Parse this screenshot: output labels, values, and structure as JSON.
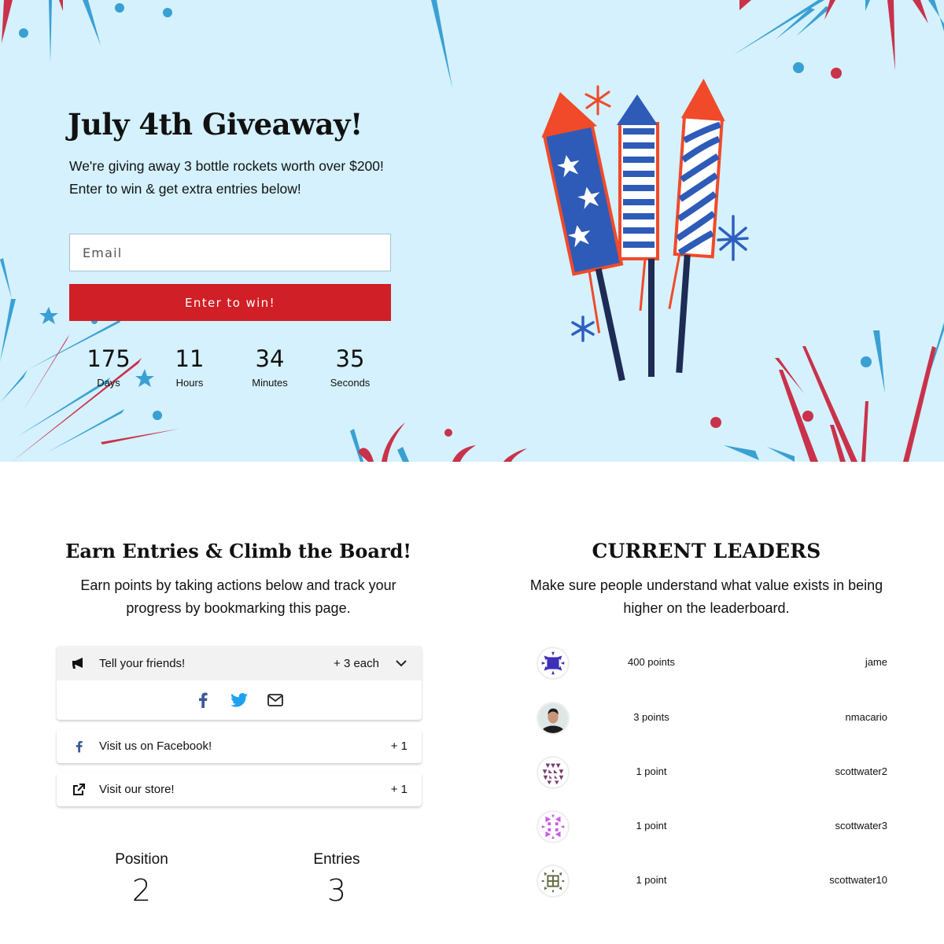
{
  "hero": {
    "title": "July 4th Giveaway!",
    "description": "We're giving away 3 bottle rockets worth over $200! Enter to win & get extra entries below!",
    "email_placeholder": "Email",
    "email_value": "",
    "submit_label": "Enter to win!",
    "image_alt": "three bottle rockets illustration"
  },
  "countdown": [
    {
      "value": "175",
      "label": "Days"
    },
    {
      "value": "11",
      "label": "Hours"
    },
    {
      "value": "34",
      "label": "Minutes"
    },
    {
      "value": "35",
      "label": "Seconds"
    }
  ],
  "earn": {
    "title": "Earn Entries & Climb the Board!",
    "description": "Earn points by taking actions below and track your progress by bookmarking this page.",
    "actions": [
      {
        "icon": "megaphone-icon",
        "label": "Tell your friends!",
        "points": "+ 3 each",
        "expanded": true,
        "share": [
          {
            "icon": "facebook-icon"
          },
          {
            "icon": "twitter-icon"
          },
          {
            "icon": "email-icon"
          }
        ]
      },
      {
        "icon": "facebook-icon",
        "label": "Visit us on Facebook!",
        "points": "+ 1"
      },
      {
        "icon": "external-link-icon",
        "label": "Visit our store!",
        "points": "+ 1"
      }
    ]
  },
  "stats": {
    "position_label": "Position",
    "position_value": "2",
    "entries_label": "Entries",
    "entries_value": "3"
  },
  "leaders": {
    "title": "CURRENT LEADERS",
    "description": "Make sure people understand what value exists in being higher on the leaderboard.",
    "rows": [
      {
        "points": "400 points",
        "name": "jame",
        "avatar_color": "#3d2fb8"
      },
      {
        "points": "3 points",
        "name": "nmacario",
        "avatar_color": "#222222"
      },
      {
        "points": "1 point",
        "name": "scottwater2",
        "avatar_color": "#7a3e6e"
      },
      {
        "points": "1 point",
        "name": "scottwater3",
        "avatar_color": "#c85ee0"
      },
      {
        "points": "1 point",
        "name": "scottwater10",
        "avatar_color": "#5f6a3c"
      }
    ]
  },
  "colors": {
    "hero_bg": "#d4f1fd",
    "accent_red": "#d01f26",
    "firework_blue": "#3aa0d3",
    "firework_red": "#c9324a",
    "facebook_blue": "#3b5998",
    "twitter_blue": "#1da1f2"
  }
}
